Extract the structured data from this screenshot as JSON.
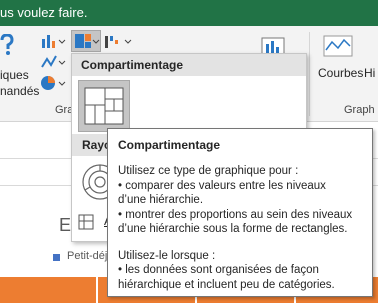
{
  "titlebar": {
    "tell_me": "us voulez faire.",
    "color": "#217346"
  },
  "ribbon": {
    "left_button_text_line1": "iques",
    "left_button_text_line2": "nandés",
    "group_label_charts": "Gra",
    "line_charts_label": "Courbes",
    "hi_label_partial": "Hi",
    "group_label_sparklines": "Graph"
  },
  "dropdown": {
    "header": "Compartimentage",
    "section2_label": "Rayo",
    "bottom_label": "A",
    "icons": {
      "treemap": "treemap-icon",
      "sunburst": "sunburst-icon",
      "more": "more-charts-icon"
    }
  },
  "tooltip": {
    "title": "Compartimentage",
    "lines": [
      "Utilisez ce type de graphique pour :",
      "• comparer des valeurs entre les niveaux",
      "d’une hiérarchie.",
      "• montrer des proportions au sein des niveaux",
      "d’une hiérarchie sous la forme de rectangles."
    ],
    "lines2": [
      "Utilisez-le lorsque :",
      "• les données sont organisées de façon",
      "hiérarchique et incluent peu de catégories."
    ]
  },
  "sheet": {
    "chart_title_partial": "E",
    "legend_label": "Petit-déj",
    "accent_blue": "#4472c4",
    "accent_orange": "#ed7d31"
  }
}
